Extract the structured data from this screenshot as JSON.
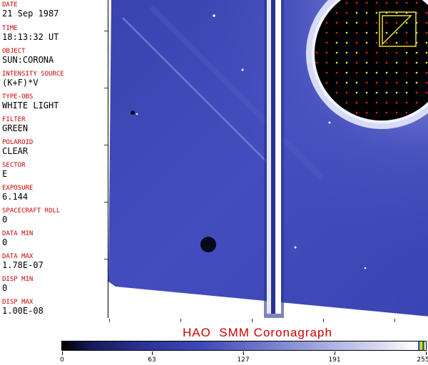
{
  "metadata": {
    "date": {
      "label": "DATE",
      "value": "21 Sep 1987"
    },
    "time": {
      "label": "TIME",
      "value": "18:13:32 UT"
    },
    "object": {
      "label": "OBJECT",
      "value": "SUN:CORONA"
    },
    "intensity_source": {
      "label": "INTENSITY SOURCE",
      "value": "(K+F)*V"
    },
    "type_obs": {
      "label": "TYPE-OBS",
      "value": "WHITE LIGHT"
    },
    "filter": {
      "label": "FILTER",
      "value": "GREEN"
    },
    "polaroid": {
      "label": "POLAROID",
      "value": "CLEAR"
    },
    "sector": {
      "label": "SECTOR",
      "value": "E"
    },
    "exposure": {
      "label": "EXPOSURE",
      "value": "6.144"
    },
    "spacecraft_roll": {
      "label": "SPACECRAFT ROLL",
      "value": "0"
    },
    "data_min": {
      "label": "DATA MIN",
      "value": "0"
    },
    "data_max": {
      "label": "DATA MAX",
      "value": "1.78E-07"
    },
    "disp_min": {
      "label": "DISP MIN",
      "value": "0"
    },
    "disp_max": {
      "label": "DISP MAX",
      "value": "1.00E-08"
    }
  },
  "colorbar": {
    "title": "HAO  SMM Coronagraph",
    "ticks": [
      "0",
      "63",
      "127",
      "191",
      "255"
    ]
  },
  "colors": {
    "label_red": "#cc0000",
    "corona_blue": "#3e48b8",
    "grid_red": "#e02020",
    "grid_yellow": "#f0e030"
  }
}
